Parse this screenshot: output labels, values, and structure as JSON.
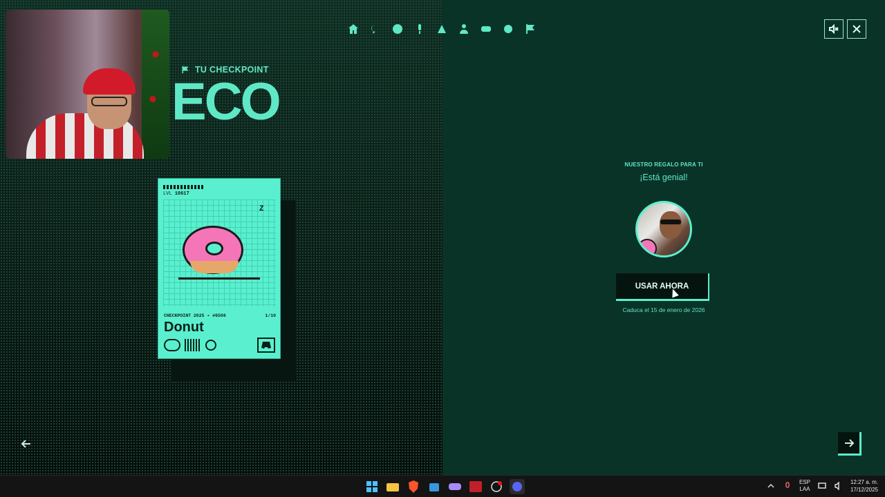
{
  "header": {
    "checkpoint_label": "TU CHECKPOINT",
    "big_word": "ECO"
  },
  "nav": {
    "items": [
      "home-icon",
      "chat-icon",
      "smiley-icon",
      "mic-icon",
      "podcast-icon",
      "person-icon",
      "gamepad-icon",
      "gear-icon",
      "flag-icon"
    ]
  },
  "controls": {
    "mute": "mute-icon",
    "close": "close-icon"
  },
  "card": {
    "level_prefix": "LVL",
    "level": "10617",
    "tag": "Z",
    "collection": "CHECKPOINT 2025 • #6508",
    "rarity": "1/10",
    "name": "Donut"
  },
  "gift": {
    "eyebrow": "NUESTRO REGALO PARA TI",
    "subtitle": "¡Está genial!",
    "button_label": "USAR AHORA",
    "expiry": "Caduca el 15 de enero de 2026"
  },
  "taskbar": {
    "lang_top": "ESP",
    "lang_bottom": "LAA",
    "time": "12:27 a. m.",
    "date": "17/12/2025"
  },
  "colors": {
    "accent": "#5fe8c6",
    "bg_right": "#0a3328",
    "card": "#5af0cf"
  }
}
